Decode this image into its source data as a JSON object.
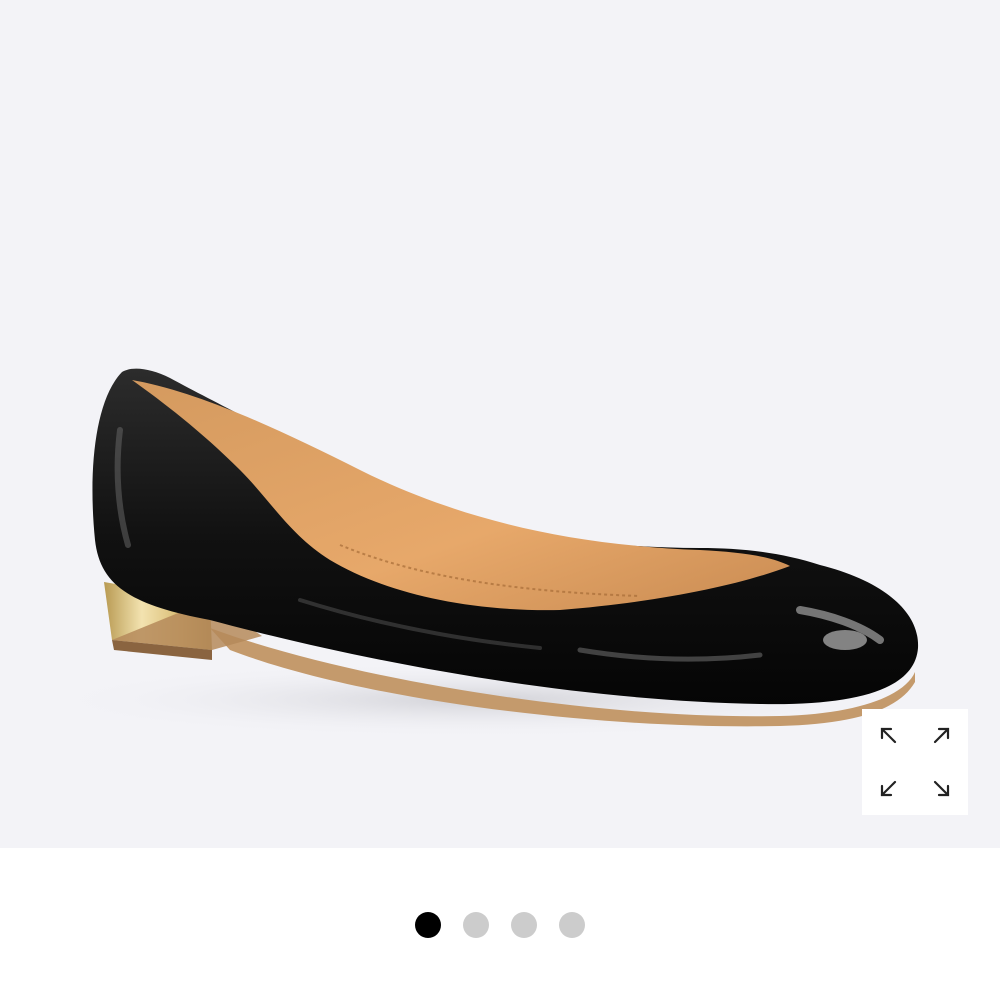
{
  "product_image": {
    "icon": "black-patent-flat-shoe",
    "background_color": "#f3f3f7"
  },
  "zoom_button": {
    "icon": "expand-arrows-icon"
  },
  "carousel": {
    "total_slides": 4,
    "active_index": 0,
    "active_color": "#000000",
    "inactive_color": "#cccccc"
  }
}
